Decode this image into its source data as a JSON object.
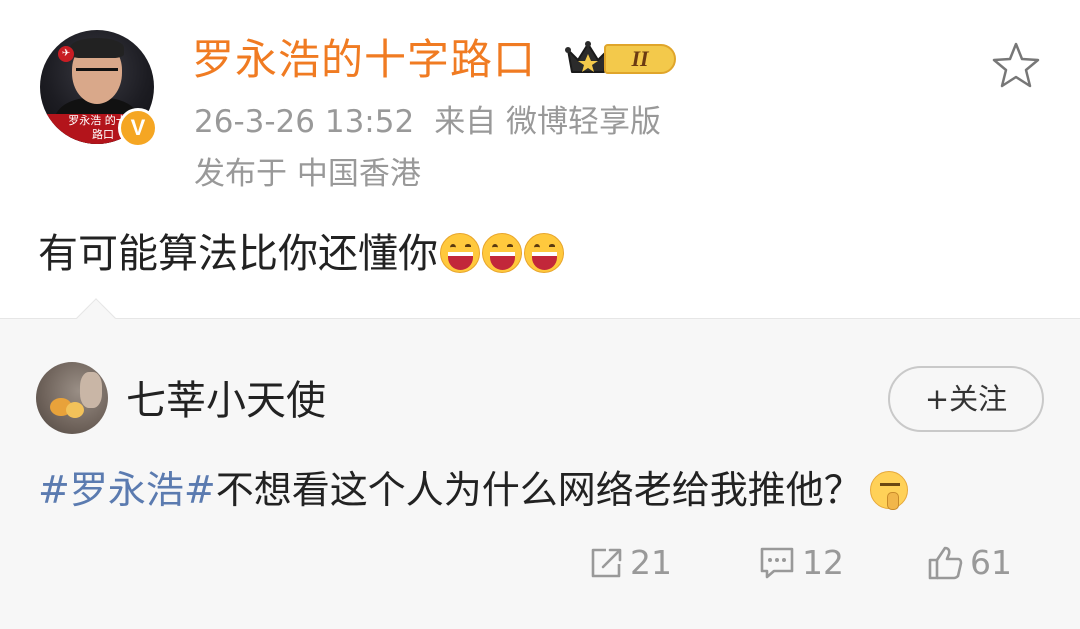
{
  "post": {
    "author": "罗永浩的十字路口",
    "avatar_caption": "罗永浩 的十字路口",
    "verified_badge": "V",
    "level_badge": "II",
    "time": "26-3-26 13:52",
    "source": "来自 微博轻享版",
    "location": "发布于 中国香港",
    "text": "有可能算法比你还懂你",
    "emoji_count": 3,
    "icons": {
      "favorite": "star-icon",
      "crown": "crown-icon",
      "verified": "verified-icon",
      "laugh": "laugh-emoji-icon"
    }
  },
  "comment": {
    "author": "七莘小天使",
    "follow_label": "+关注",
    "topic": "#罗永浩#",
    "text": "不想看这个人为什么网络老给我推他？",
    "icons": {
      "shh": "shush-emoji-icon"
    }
  },
  "actions": {
    "repost_count": "21",
    "comment_count": "12",
    "like_count": "61",
    "icons": {
      "repost": "repost-icon",
      "comment": "comment-icon",
      "like": "thumbs-up-icon"
    }
  },
  "colors": {
    "username": "#f07b22",
    "meta": "#999999",
    "topic": "#5b7bb0",
    "card_background": "#f7f7f7",
    "verified": "#f5a623"
  }
}
